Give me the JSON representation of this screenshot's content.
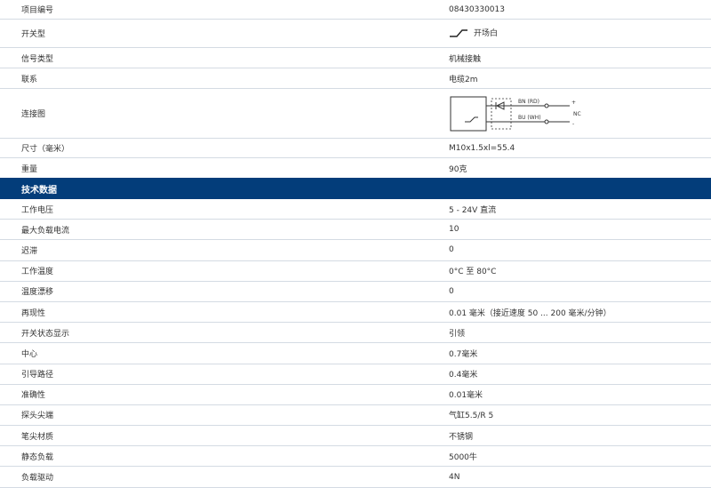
{
  "rows_top": [
    {
      "label": "项目编号",
      "value": "08430330013"
    },
    {
      "label": "开关型",
      "value": "开场白"
    },
    {
      "label": "信号类型",
      "value": "机械接触"
    },
    {
      "label": "联系",
      "value": "电缆2m"
    },
    {
      "label": "连接图",
      "value": ""
    },
    {
      "label": "尺寸（毫米）",
      "value": "M10x1.5xl=55.4"
    },
    {
      "label": "重量",
      "value": "90克"
    }
  ],
  "section_title": "技术数据",
  "rows_tech": [
    {
      "label": "工作电压",
      "value": "5 - 24V 直流"
    },
    {
      "label": "最大负载电流",
      "value": "10"
    },
    {
      "label": "迟滞",
      "value": "0"
    },
    {
      "label": "工作温度",
      "value": "0°C 至 80°C"
    },
    {
      "label": "温度漂移",
      "value": "0"
    },
    {
      "label": "再现性",
      "value": "0.01 毫米（接近速度 50 ... 200 毫米/分钟）"
    },
    {
      "label": "开关状态显示",
      "value": "引领"
    },
    {
      "label": "中心",
      "value": "0.7毫米"
    },
    {
      "label": "引导路径",
      "value": "0.4毫米"
    },
    {
      "label": "准确性",
      "value": "0.01毫米"
    },
    {
      "label": "探头尖端",
      "value": "气缸5.5/R 5"
    },
    {
      "label": "笔尖材质",
      "value": "不锈钢"
    },
    {
      "label": "静态负载",
      "value": "5000牛"
    },
    {
      "label": "负载驱动",
      "value": "4N"
    }
  ],
  "diagram": {
    "bn_label": "BN (RD)",
    "bu_label": "BU (WH)",
    "plus": "+",
    "minus": "-",
    "nc": "NC"
  },
  "colors": {
    "header_bg": "#033d7a",
    "row_border": "#d4dbe3"
  },
  "icons": {
    "switch_type": "normally-open-switch-icon"
  }
}
